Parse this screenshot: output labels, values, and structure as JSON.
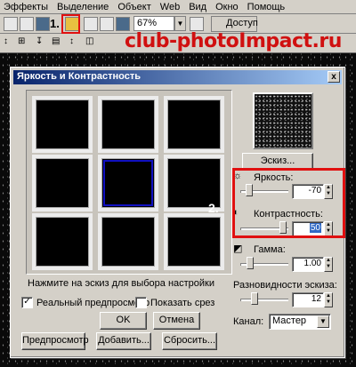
{
  "menu": {
    "items": [
      "Эффекты",
      "Выделение",
      "Объект",
      "Web",
      "Вид",
      "Окно",
      "Помощь"
    ]
  },
  "toolbar": {
    "zoom_value": "67%",
    "access_label": "Доступ",
    "marker_1": "1."
  },
  "watermark": "club-photoImpact.ru",
  "dialog": {
    "title": "Яркость и Контрастность",
    "close_label": "x",
    "sketch_button": "Эскиз...",
    "brightness_label": "Яркость:",
    "brightness_value": "-70",
    "contrast_label": "Контрастность:",
    "contrast_value": "50",
    "gamma_label": "Гамма:",
    "gamma_value": "1.00",
    "variation_label": "Разновидности эскиза:",
    "variation_value": "12",
    "channel_label": "Канал:",
    "channel_value": "Мастер",
    "hint_text": "Нажмите на эскиз для выбора настройки",
    "realtime_label": "Реальный предпросмотр",
    "realtime_checked": true,
    "show_cut_label": "Показать срез",
    "show_cut_checked": false,
    "ok_label": "OK",
    "cancel_label": "Отмена",
    "preview_label": "Предпросмотр",
    "add_label": "Добавить...",
    "reset_label": "Сбросить...",
    "marker_2": "2.",
    "selected_thumb_index": 4
  }
}
